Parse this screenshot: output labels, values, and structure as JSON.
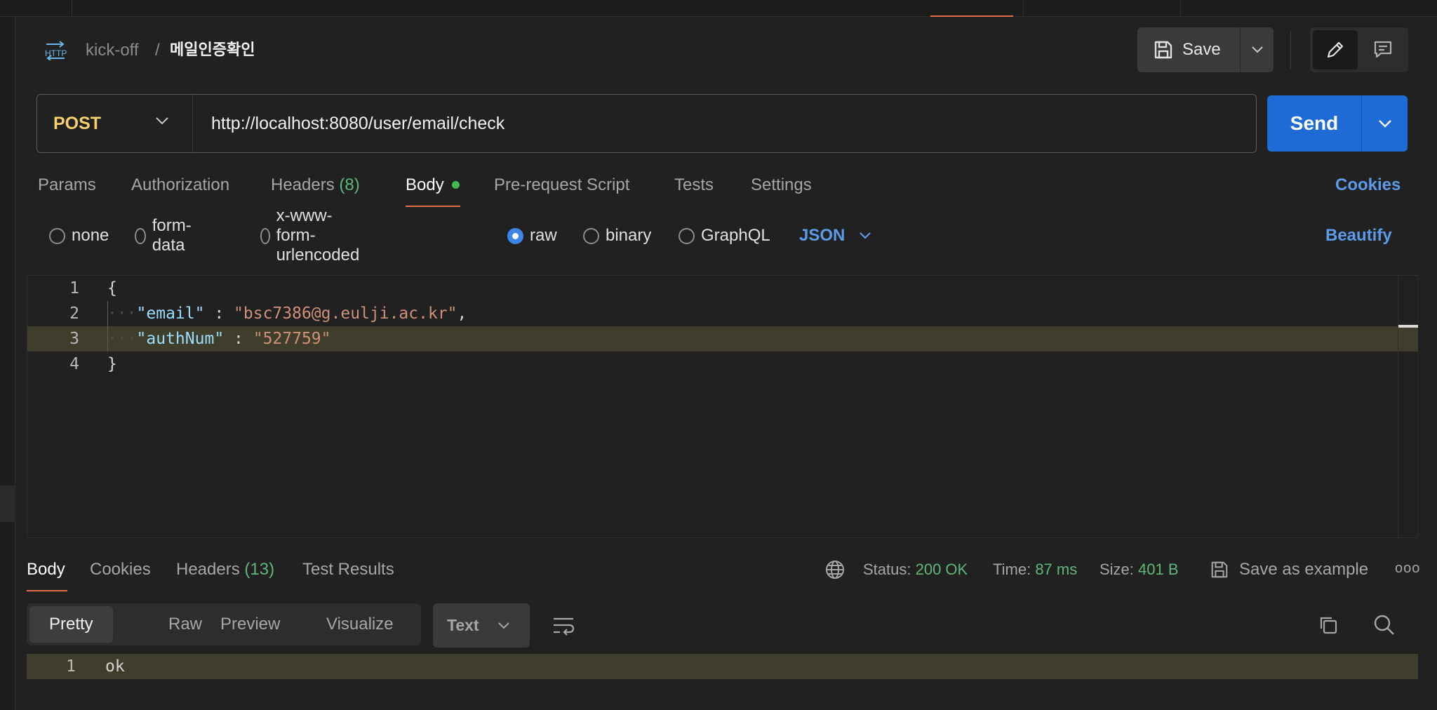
{
  "header": {
    "badge": "HTTP",
    "collection": "kick-off",
    "separator": "/",
    "request_name": "메일인증확인",
    "save_label": "Save"
  },
  "request": {
    "method": "POST",
    "url": "http://localhost:8080/user/email/check",
    "send_label": "Send"
  },
  "request_tabs": {
    "params": "Params",
    "authorization": "Authorization",
    "headers": "Headers",
    "headers_count": "(8)",
    "body": "Body",
    "pre_request": "Pre-request Script",
    "tests": "Tests",
    "settings": "Settings",
    "cookies": "Cookies"
  },
  "body_types": {
    "none": "none",
    "form_data": "form-data",
    "urlencoded": "x-www-form-urlencoded",
    "raw": "raw",
    "binary": "binary",
    "graphql": "GraphQL",
    "selected": "raw",
    "language": "JSON",
    "beautify": "Beautify"
  },
  "editor": {
    "line_numbers": [
      "1",
      "2",
      "3",
      "4"
    ],
    "open_brace": "{",
    "email_key": "\"email\"",
    "email_value": "\"bsc7386@g.eulji.ac.kr\"",
    "auth_key": "\"authNum\"",
    "auth_value": "\"527759\"",
    "colon": " : ",
    "comma": ",",
    "close_brace": "}"
  },
  "response": {
    "tabs": {
      "body": "Body",
      "cookies": "Cookies",
      "headers": "Headers",
      "headers_count": "(13)",
      "test_results": "Test Results"
    },
    "status_label": "Status:",
    "status_value": "200 OK",
    "time_label": "Time:",
    "time_value": "87 ms",
    "size_label": "Size:",
    "size_value": "401 B",
    "save_example": "Save as example",
    "more": "ooo",
    "formats": {
      "pretty": "Pretty",
      "raw": "Raw",
      "preview": "Preview",
      "visualize": "Visualize"
    },
    "text_type": "Text",
    "line_number": "1",
    "content": "ok"
  },
  "colors": {
    "accent": "#e0714b",
    "send": "#1f6bd6",
    "link": "#5b9be8",
    "success": "#5fb87a",
    "method": "#f5d06b"
  }
}
